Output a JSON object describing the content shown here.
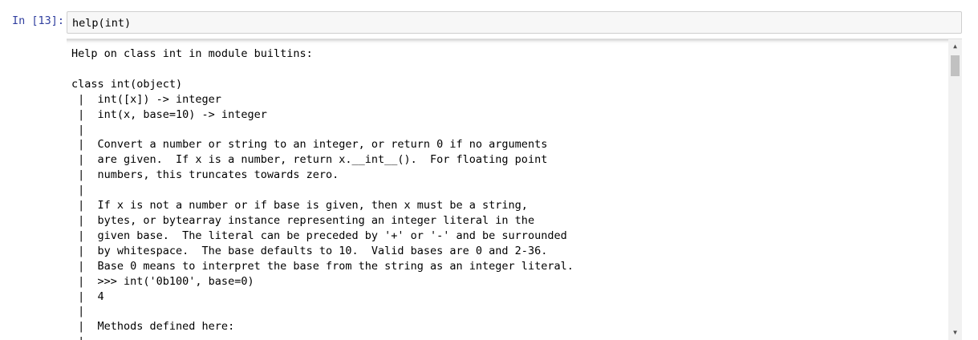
{
  "cell": {
    "prompt": "In [13]:",
    "input": "help(int)"
  },
  "output": {
    "text": "Help on class int in module builtins:\n\nclass int(object)\n |  int([x]) -> integer\n |  int(x, base=10) -> integer\n |\n |  Convert a number or string to an integer, or return 0 if no arguments\n |  are given.  If x is a number, return x.__int__().  For floating point\n |  numbers, this truncates towards zero.\n |\n |  If x is not a number or if base is given, then x must be a string,\n |  bytes, or bytearray instance representing an integer literal in the\n |  given base.  The literal can be preceded by '+' or '-' and be surrounded\n |  by whitespace.  The base defaults to 10.  Valid bases are 0 and 2-36.\n |  Base 0 means to interpret the base from the string as an integer literal.\n |  >>> int('0b100', base=0)\n |  4\n |\n |  Methods defined here:\n |"
  },
  "scrollbar": {
    "up_icon": "scroll-up-arrow",
    "down_icon": "scroll-down-arrow"
  },
  "colors": {
    "prompt": "#303f9f",
    "input_background": "#f7f7f7",
    "input_border": "#cfcfcf"
  }
}
